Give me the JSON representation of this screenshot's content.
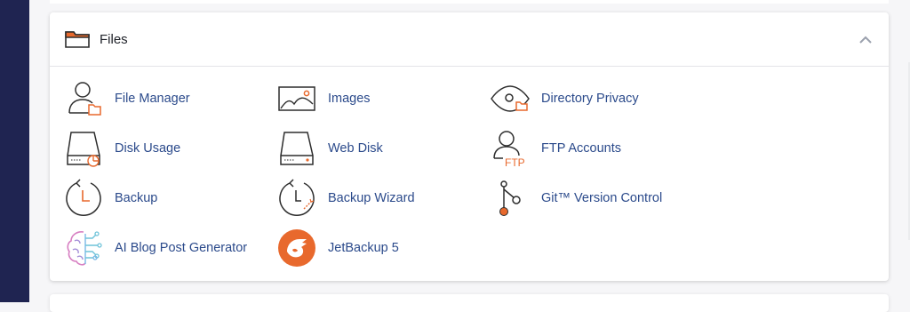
{
  "panel": {
    "title": "Files",
    "items": [
      {
        "label": "File Manager",
        "icon": "file-manager-icon"
      },
      {
        "label": "Images",
        "icon": "images-icon"
      },
      {
        "label": "Directory Privacy",
        "icon": "directory-privacy-icon"
      },
      {
        "label": "Disk Usage",
        "icon": "disk-usage-icon"
      },
      {
        "label": "Web Disk",
        "icon": "web-disk-icon"
      },
      {
        "label": "FTP Accounts",
        "icon": "ftp-accounts-icon",
        "icon_text": "FTP"
      },
      {
        "label": "Backup",
        "icon": "backup-icon"
      },
      {
        "label": "Backup Wizard",
        "icon": "backup-wizard-icon"
      },
      {
        "label": "Git™ Version Control",
        "icon": "git-version-control-icon"
      },
      {
        "label": "AI Blog Post Generator",
        "icon": "ai-blog-post-generator-icon"
      },
      {
        "label": "JetBackup 5",
        "icon": "jetbackup-icon"
      }
    ]
  },
  "colors": {
    "sidebar": "#1f2451",
    "link": "#2b4a8b",
    "accent": "#e8692d",
    "icon_stroke": "#2d2d2d"
  }
}
